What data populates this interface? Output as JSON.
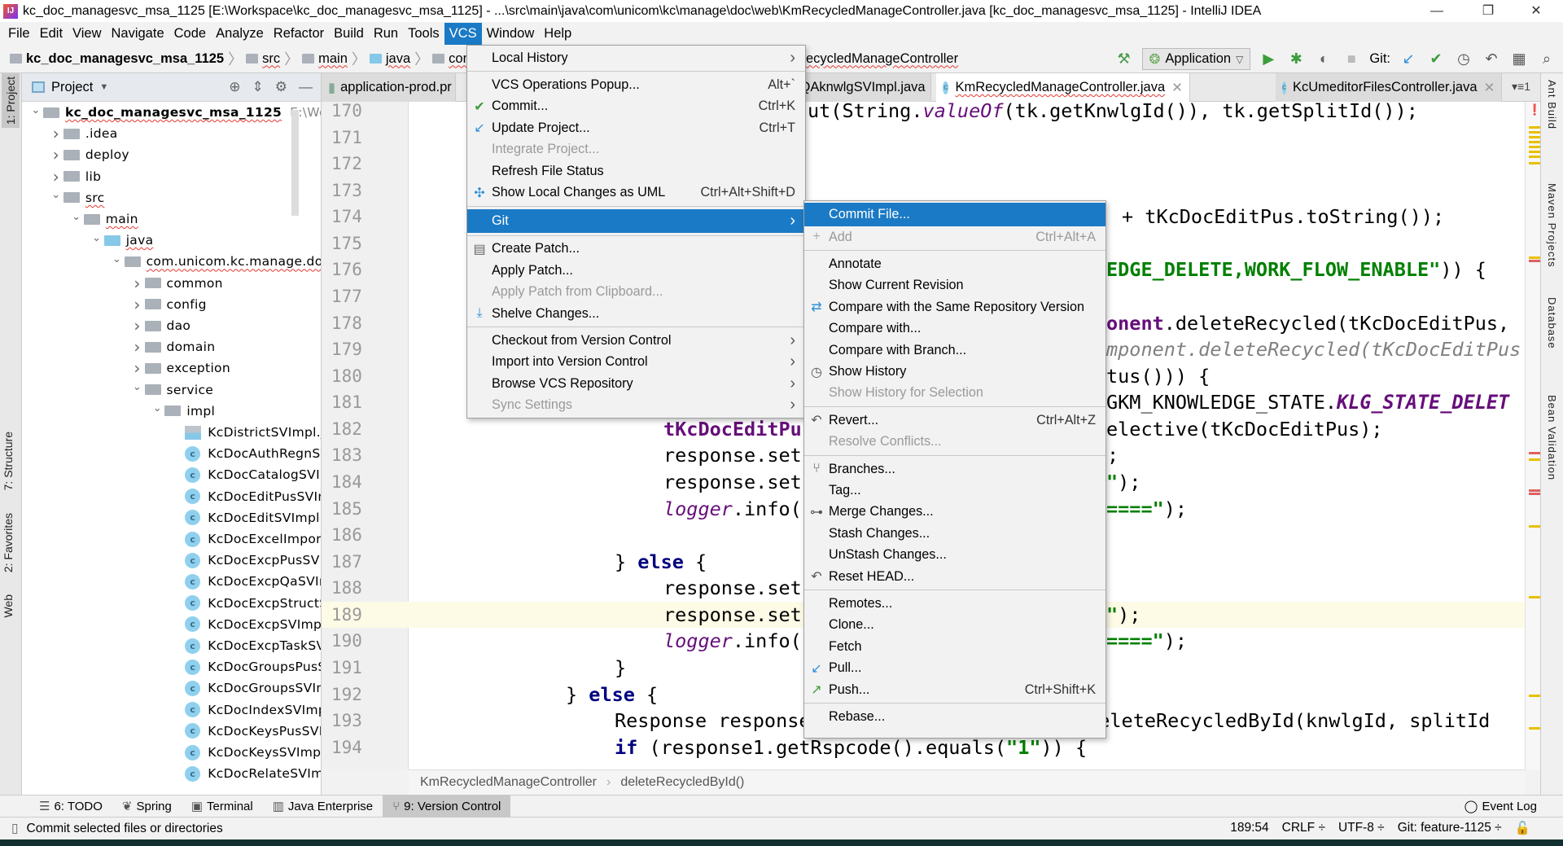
{
  "window": {
    "title": "kc_doc_managesvc_msa_1125 [E:\\Workspace\\kc_doc_managesvc_msa_1125] - ...\\src\\main\\java\\com\\unicom\\kc\\manage\\doc\\web\\KmRecycledManageController.java [kc_doc_managesvc_msa_1125] - IntelliJ IDEA",
    "minimize": "—",
    "restore": "❐",
    "close": "✕"
  },
  "menubar": [
    "File",
    "Edit",
    "View",
    "Navigate",
    "Code",
    "Analyze",
    "Refactor",
    "Build",
    "Run",
    "Tools",
    "VCS",
    "Window",
    "Help"
  ],
  "menubar_active": "VCS",
  "navbar": {
    "crumbs": [
      "kc_doc_managesvc_msa_1125",
      "src",
      "main",
      "java",
      "com",
      ""
    ],
    "tail": "ecycledManageController"
  },
  "toolbar": {
    "run_config": "Application",
    "git_label": "Git:"
  },
  "left_strip": [
    "1: Project",
    "7: Structure",
    "2: Favorites",
    "Web"
  ],
  "right_strip": [
    "Ant Build",
    "Maven Projects",
    "Database",
    "Bean Validation"
  ],
  "project": {
    "header": "Project",
    "root_path": "E:\\Workspa",
    "tree": [
      {
        "label": "kc_doc_managesvc_msa_1125",
        "level": 0,
        "expanded": true,
        "type": "module",
        "bold": true,
        "squig": true
      },
      {
        "label": ".idea",
        "level": 1,
        "expanded": false,
        "type": "folder"
      },
      {
        "label": "deploy",
        "level": 1,
        "expanded": false,
        "type": "folder"
      },
      {
        "label": "lib",
        "level": 1,
        "expanded": false,
        "type": "folder"
      },
      {
        "label": "src",
        "level": 1,
        "expanded": true,
        "type": "folder",
        "squig": true
      },
      {
        "label": "main",
        "level": 2,
        "expanded": true,
        "type": "folder",
        "squig": true
      },
      {
        "label": "java",
        "level": 3,
        "expanded": true,
        "type": "source",
        "squig": true
      },
      {
        "label": "com.unicom.kc.manage.doc",
        "level": 4,
        "expanded": true,
        "type": "package",
        "squig": true
      },
      {
        "label": "common",
        "level": 5,
        "expanded": false,
        "type": "package"
      },
      {
        "label": "config",
        "level": 5,
        "expanded": false,
        "type": "package"
      },
      {
        "label": "dao",
        "level": 5,
        "expanded": false,
        "type": "package"
      },
      {
        "label": "domain",
        "level": 5,
        "expanded": false,
        "type": "package"
      },
      {
        "label": "exception",
        "level": 5,
        "expanded": false,
        "type": "package"
      },
      {
        "label": "service",
        "level": 5,
        "expanded": true,
        "type": "package"
      },
      {
        "label": "impl",
        "level": 6,
        "expanded": true,
        "type": "package"
      },
      {
        "label": "KcDistrictSVImpl.jav",
        "level": 7,
        "type": "javafile"
      },
      {
        "label": "KcDocAuthRegnSVI",
        "level": 7,
        "type": "class"
      },
      {
        "label": "KcDocCatalogSVIm",
        "level": 7,
        "type": "class"
      },
      {
        "label": "KcDocEditPusSVImp",
        "level": 7,
        "type": "class"
      },
      {
        "label": "KcDocEditSVImpl",
        "level": 7,
        "type": "class"
      },
      {
        "label": "KcDocExcelImportS",
        "level": 7,
        "type": "class"
      },
      {
        "label": "KcDocExcpPusSVIm",
        "level": 7,
        "type": "class"
      },
      {
        "label": "KcDocExcpQaSVImp",
        "level": 7,
        "type": "class"
      },
      {
        "label": "KcDocExcpStructSV",
        "level": 7,
        "type": "class"
      },
      {
        "label": "KcDocExcpSVImpl",
        "level": 7,
        "type": "class"
      },
      {
        "label": "KcDocExcpTaskSVIr",
        "level": 7,
        "type": "class"
      },
      {
        "label": "KcDocGroupsPusSV",
        "level": 7,
        "type": "class"
      },
      {
        "label": "KcDocGroupsSVImp",
        "level": 7,
        "type": "class"
      },
      {
        "label": "KcDocIndexSVImpl",
        "level": 7,
        "type": "class"
      },
      {
        "label": "KcDocKeysPusSVIm",
        "level": 7,
        "type": "class"
      },
      {
        "label": "KcDocKeysSVImpl",
        "level": 7,
        "type": "class"
      },
      {
        "label": "KcDocRelateSVImpl",
        "level": 7,
        "type": "class"
      }
    ]
  },
  "tabs": [
    {
      "label": "application-prod.pr",
      "type": "props"
    },
    {
      "label": "KcUploadQAknwlgSVImpl.java",
      "type": "class"
    },
    {
      "label": "KmRecycledManageController.java",
      "type": "class",
      "active": true
    },
    {
      "label": "KcUmeditorFilesController.java",
      "type": "class"
    }
  ],
  "tabs_overflow": "▾≡1",
  "editor": {
    "current_line": 189,
    "lines": [
      {
        "n": 170,
        "frags": [
          [
            [
              "ut(String.",
              ""
            ],
            [
              "valueOf",
              "t-it"
            ],
            [
              "(tk.getKnwlgId()), tk.getSplitId());",
              ""
            ]
          ]
        ]
      },
      {
        "n": 171,
        "frags": []
      },
      {
        "n": 172,
        "frags": []
      },
      {
        "n": 173,
        "frags": []
      },
      {
        "n": 174,
        "frags": [
          [
            [
              "+ tKcDocEditPus.toString());",
              ""
            ]
          ]
        ]
      },
      {
        "n": 175,
        "frags": []
      },
      {
        "n": 176,
        "frags": [
          [
            [
              "EDGE_DELETE,WORK_FLOW_ENABLE\"",
              "t-str"
            ],
            [
              ")) {",
              ""
            ]
          ]
        ]
      },
      {
        "n": 177,
        "frags": []
      },
      {
        "n": 178,
        "frags": [
          [
            [
              "onent",
              "t-st"
            ],
            [
              ".deleteRecycled(tKcDocEditPus,",
              ""
            ]
          ]
        ]
      },
      {
        "n": 179,
        "frags": [
          [
            [
              "mponent.deleteRecycled(tKcDocEditPus",
              "t-cm"
            ]
          ]
        ]
      },
      {
        "n": 180,
        "frags": [
          [
            [
              "tus())) {",
              ""
            ]
          ]
        ]
      },
      {
        "n": 181,
        "frags": [
          [
            [
              "tKcDocEditPu",
              ""
            ]
          ],
          [
            [
              "GKM_KNOWLEDGE_STATE.",
              ""
            ],
            [
              "KLG_STATE_DELET",
              "t-sti"
            ]
          ]
        ]
      },
      {
        "n": 182,
        "frags": [
          [
            [
              "tKcDocEditPu",
              "t-st"
            ]
          ],
          [
            [
              "elective(tKcDocEditPus);",
              ""
            ]
          ]
        ]
      },
      {
        "n": 183,
        "frags": [
          [
            [
              "response.set",
              ""
            ]
          ],
          [
            [
              ";",
              ""
            ]
          ]
        ]
      },
      {
        "n": 184,
        "frags": [
          [
            [
              "response.set",
              ""
            ]
          ],
          [
            [
              "\"",
              "t-str"
            ],
            [
              ");",
              ""
            ]
          ]
        ]
      },
      {
        "n": 185,
        "frags": [
          [
            [
              "logger",
              "t-it"
            ],
            [
              ".info(",
              ""
            ]
          ],
          [
            [
              "====\"",
              "t-str"
            ],
            [
              ");",
              ""
            ]
          ]
        ]
      },
      {
        "n": 186,
        "frags": []
      },
      {
        "n": 187,
        "frags": [
          [
            [
              "} ",
              ""
            ],
            [
              "else",
              "t-kw"
            ],
            [
              " {",
              ""
            ]
          ]
        ]
      },
      {
        "n": 188,
        "frags": [
          [
            [
              "response.set",
              ""
            ]
          ]
        ]
      },
      {
        "n": 189,
        "frags": [
          [
            [
              "response.set",
              ""
            ]
          ],
          [
            [
              "\"",
              "t-str"
            ],
            [
              ");",
              ""
            ]
          ]
        ]
      },
      {
        "n": 190,
        "frags": [
          [
            [
              "logger",
              "t-it"
            ],
            [
              ".info(",
              ""
            ]
          ],
          [
            [
              "====\"",
              "t-str"
            ],
            [
              ");",
              ""
            ]
          ]
        ]
      },
      {
        "n": 191,
        "frags": [
          [
            [
              "}",
              ""
            ]
          ]
        ]
      },
      {
        "n": 192,
        "frags": [
          [
            [
              "} ",
              ""
            ],
            [
              "else",
              "t-kw"
            ],
            [
              " {",
              ""
            ]
          ]
        ]
      },
      {
        "n": 193,
        "frags": [
          [
            [
              "Response response1 = ",
              ""
            ],
            [
              "iKmRecycledManageSV",
              "t-st"
            ],
            [
              ".deleteRecycledById(knwlgId, splitId",
              ""
            ]
          ]
        ]
      },
      {
        "n": 194,
        "frags": [
          [
            [
              "if",
              "t-kw"
            ],
            [
              " (response1.getRspcode().equals(",
              ""
            ],
            [
              "\"1\"",
              "t-str"
            ],
            [
              ")) {",
              ""
            ]
          ]
        ]
      }
    ]
  },
  "editor_breadcrumbs": [
    "KmRecycledManageController",
    "deleteRecycledById()"
  ],
  "vcs_menu": [
    {
      "label": "Local History",
      "sub": true
    },
    {
      "sep": true
    },
    {
      "label": "VCS Operations Popup...",
      "shortcut": "Alt+`"
    },
    {
      "label": "Commit...",
      "shortcut": "Ctrl+K",
      "icon": "check-icon"
    },
    {
      "label": "Update Project...",
      "shortcut": "Ctrl+T",
      "icon": "update-icon"
    },
    {
      "label": "Integrate Project...",
      "disabled": true
    },
    {
      "label": "Refresh File Status"
    },
    {
      "label": "Show Local Changes as UML",
      "shortcut": "Ctrl+Alt+Shift+D",
      "icon": "uml-icon"
    },
    {
      "sep": true
    },
    {
      "label": "Git",
      "sub": true,
      "highlight": true
    },
    {
      "sep": true
    },
    {
      "label": "Create Patch...",
      "icon": "patch-icon"
    },
    {
      "label": "Apply Patch..."
    },
    {
      "label": "Apply Patch from Clipboard...",
      "disabled": true
    },
    {
      "label": "Shelve Changes...",
      "icon": "shelve-icon"
    },
    {
      "sep": true
    },
    {
      "label": "Checkout from Version Control",
      "sub": true
    },
    {
      "label": "Import into Version Control",
      "sub": true
    },
    {
      "label": "Browse VCS Repository",
      "sub": true
    },
    {
      "label": "Sync Settings",
      "sub": true,
      "disabled": true
    }
  ],
  "git_menu": [
    {
      "label": "Commit File...",
      "highlight": true
    },
    {
      "label": "Add",
      "shortcut": "Ctrl+Alt+A",
      "disabled": true,
      "icon": "plus-icon"
    },
    {
      "sep": true
    },
    {
      "label": "Annotate"
    },
    {
      "label": "Show Current Revision"
    },
    {
      "label": "Compare with the Same Repository Version",
      "icon": "compare-icon"
    },
    {
      "label": "Compare with..."
    },
    {
      "label": "Compare with Branch..."
    },
    {
      "label": "Show History",
      "icon": "history-icon"
    },
    {
      "label": "Show History for Selection",
      "disabled": true
    },
    {
      "sep": true
    },
    {
      "label": "Revert...",
      "shortcut": "Ctrl+Alt+Z",
      "icon": "revert-icon"
    },
    {
      "label": "Resolve Conflicts...",
      "disabled": true
    },
    {
      "sep": true
    },
    {
      "label": "Branches...",
      "icon": "branch-icon"
    },
    {
      "label": "Tag..."
    },
    {
      "label": "Merge Changes...",
      "icon": "merge-icon"
    },
    {
      "label": "Stash Changes..."
    },
    {
      "label": "UnStash Changes..."
    },
    {
      "label": "Reset HEAD...",
      "icon": "reset-icon"
    },
    {
      "sep": true
    },
    {
      "label": "Remotes..."
    },
    {
      "label": "Clone..."
    },
    {
      "label": "Fetch"
    },
    {
      "label": "Pull...",
      "icon": "pull-icon"
    },
    {
      "label": "Push...",
      "shortcut": "Ctrl+Shift+K",
      "icon": "push-icon"
    },
    {
      "sep": true
    },
    {
      "label": "Rebase..."
    }
  ],
  "bottom_tools": [
    {
      "label": "6: TODO",
      "icon": "todo-icon"
    },
    {
      "label": "Spring",
      "icon": "spring-icon"
    },
    {
      "label": "Terminal",
      "icon": "terminal-icon"
    },
    {
      "label": "Java Enterprise",
      "icon": "java-enterprise-icon"
    },
    {
      "label": "9: Version Control",
      "icon": "version-control-icon",
      "active": true
    }
  ],
  "event_log": "Event Log",
  "status": {
    "message": "Commit selected files or directories",
    "position": "189:54",
    "line_sep": "CRLF ÷",
    "encoding": "UTF-8 ÷",
    "branch": "Git: feature-1125 ÷"
  },
  "colors": {
    "accent": "#1b7ac5",
    "keyword": "#000080",
    "string": "#008000",
    "static": "#660e7a",
    "comment": "#808080"
  }
}
